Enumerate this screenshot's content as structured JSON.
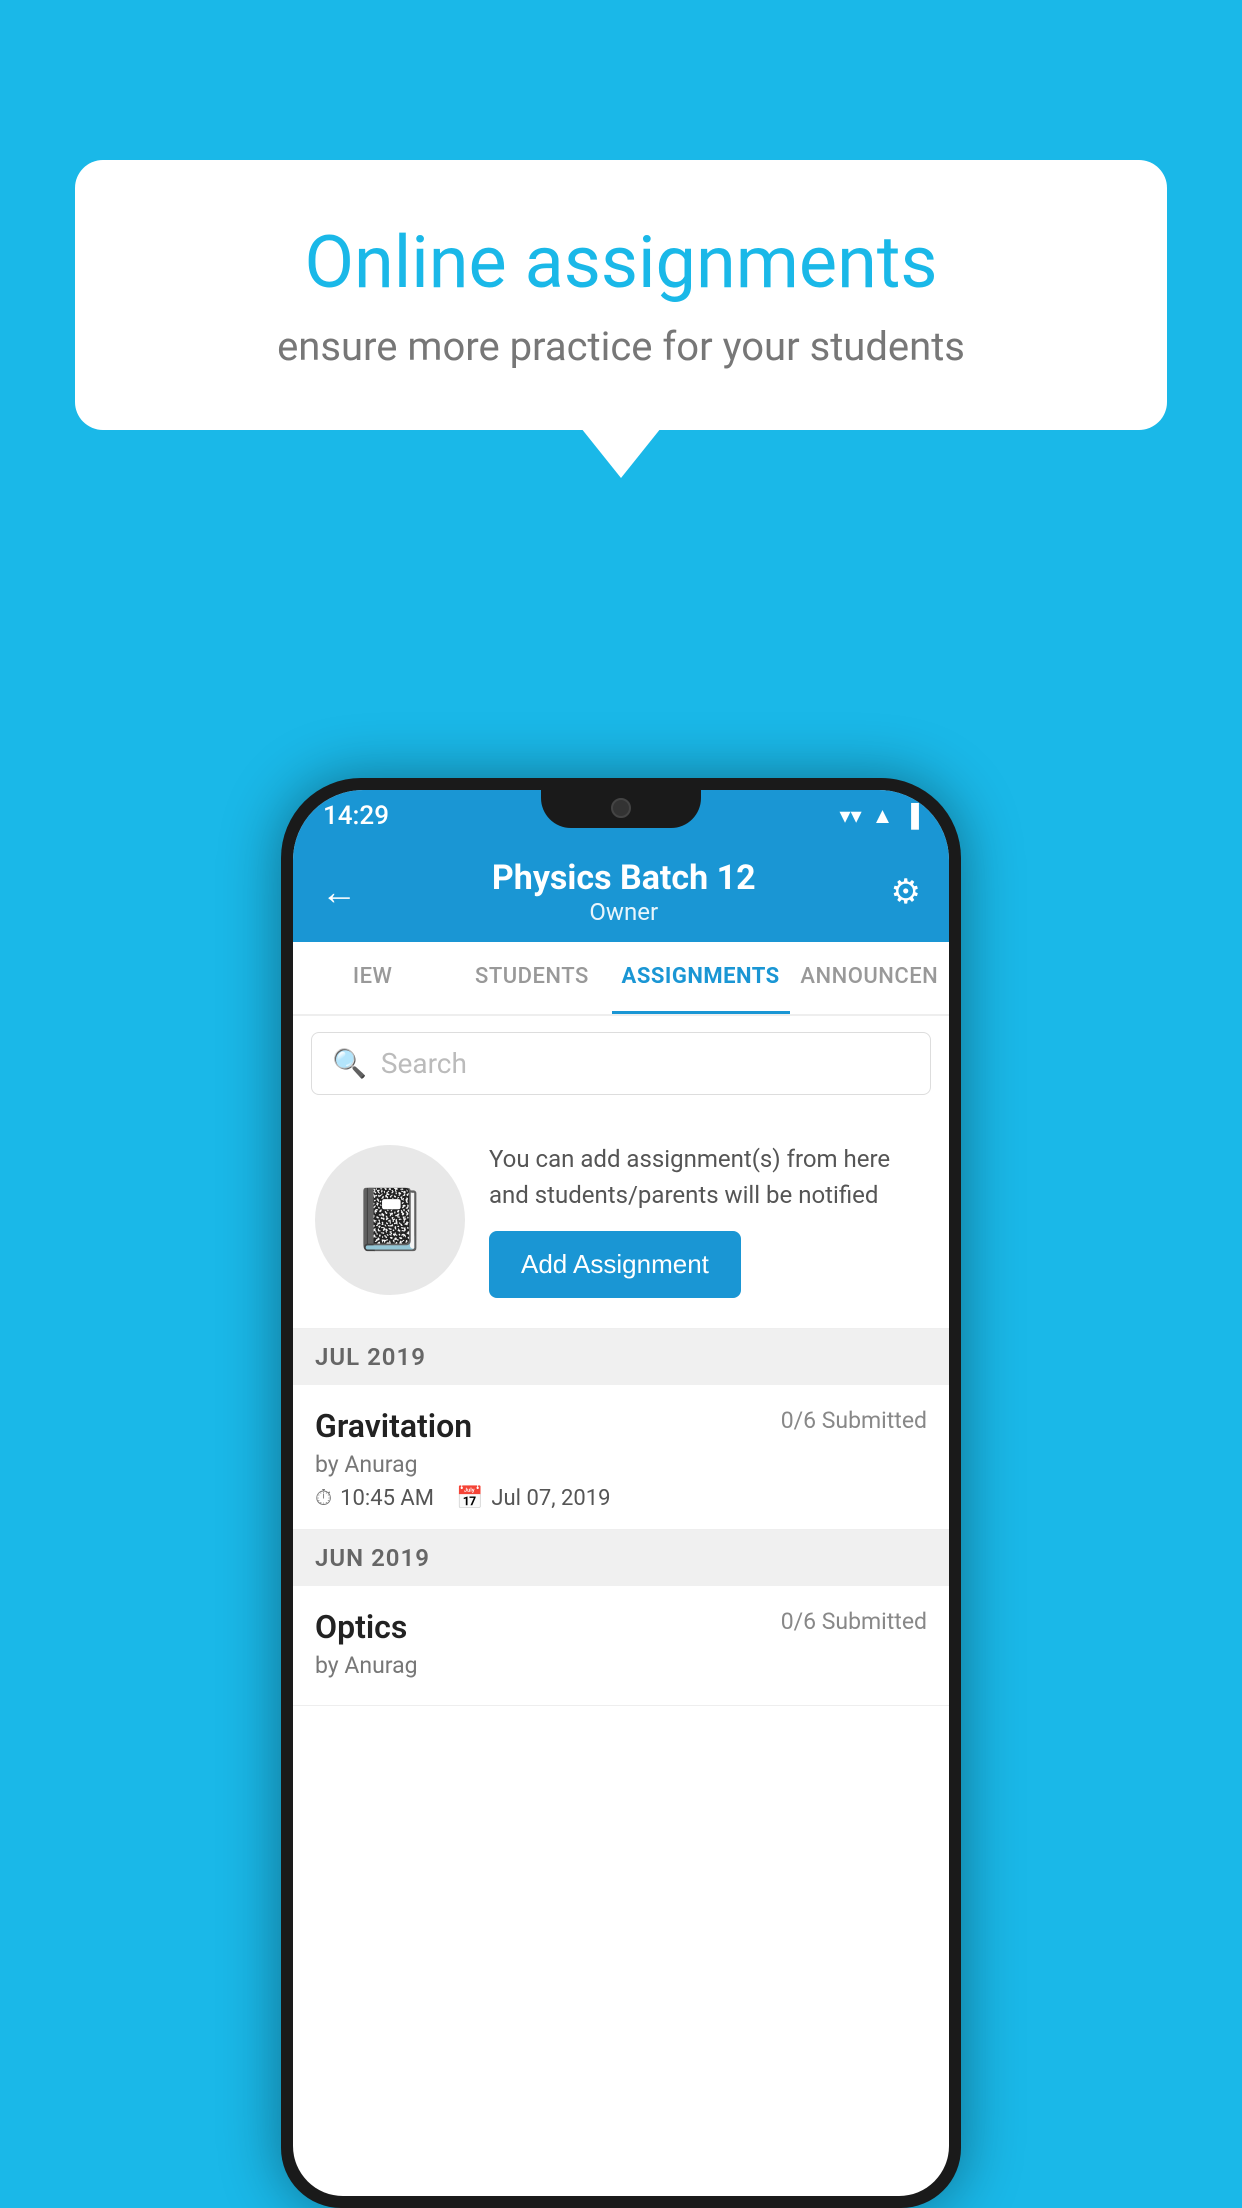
{
  "background_color": "#1ab8e8",
  "bubble": {
    "title": "Online assignments",
    "subtitle": "ensure more practice for your students"
  },
  "status_bar": {
    "time": "14:29",
    "wifi": "▲",
    "signal": "◀",
    "battery": "▮"
  },
  "app_bar": {
    "back_icon": "←",
    "title": "Physics Batch 12",
    "subtitle": "Owner",
    "settings_icon": "⚙"
  },
  "tabs": [
    {
      "label": "IEW",
      "active": false
    },
    {
      "label": "STUDENTS",
      "active": false
    },
    {
      "label": "ASSIGNMENTS",
      "active": true
    },
    {
      "label": "ANNOUNCEN",
      "active": false
    }
  ],
  "search": {
    "placeholder": "Search",
    "icon": "🔍"
  },
  "add_assignment": {
    "description": "You can add assignment(s) from here and students/parents will be notified",
    "button_label": "Add Assignment"
  },
  "sections": [
    {
      "label": "JUL 2019",
      "items": [
        {
          "name": "Gravitation",
          "submitted": "0/6 Submitted",
          "by": "by Anurag",
          "time": "10:45 AM",
          "date": "Jul 07, 2019"
        }
      ]
    },
    {
      "label": "JUN 2019",
      "items": [
        {
          "name": "Optics",
          "submitted": "0/6 Submitted",
          "by": "by Anurag",
          "time": "",
          "date": ""
        }
      ]
    }
  ]
}
